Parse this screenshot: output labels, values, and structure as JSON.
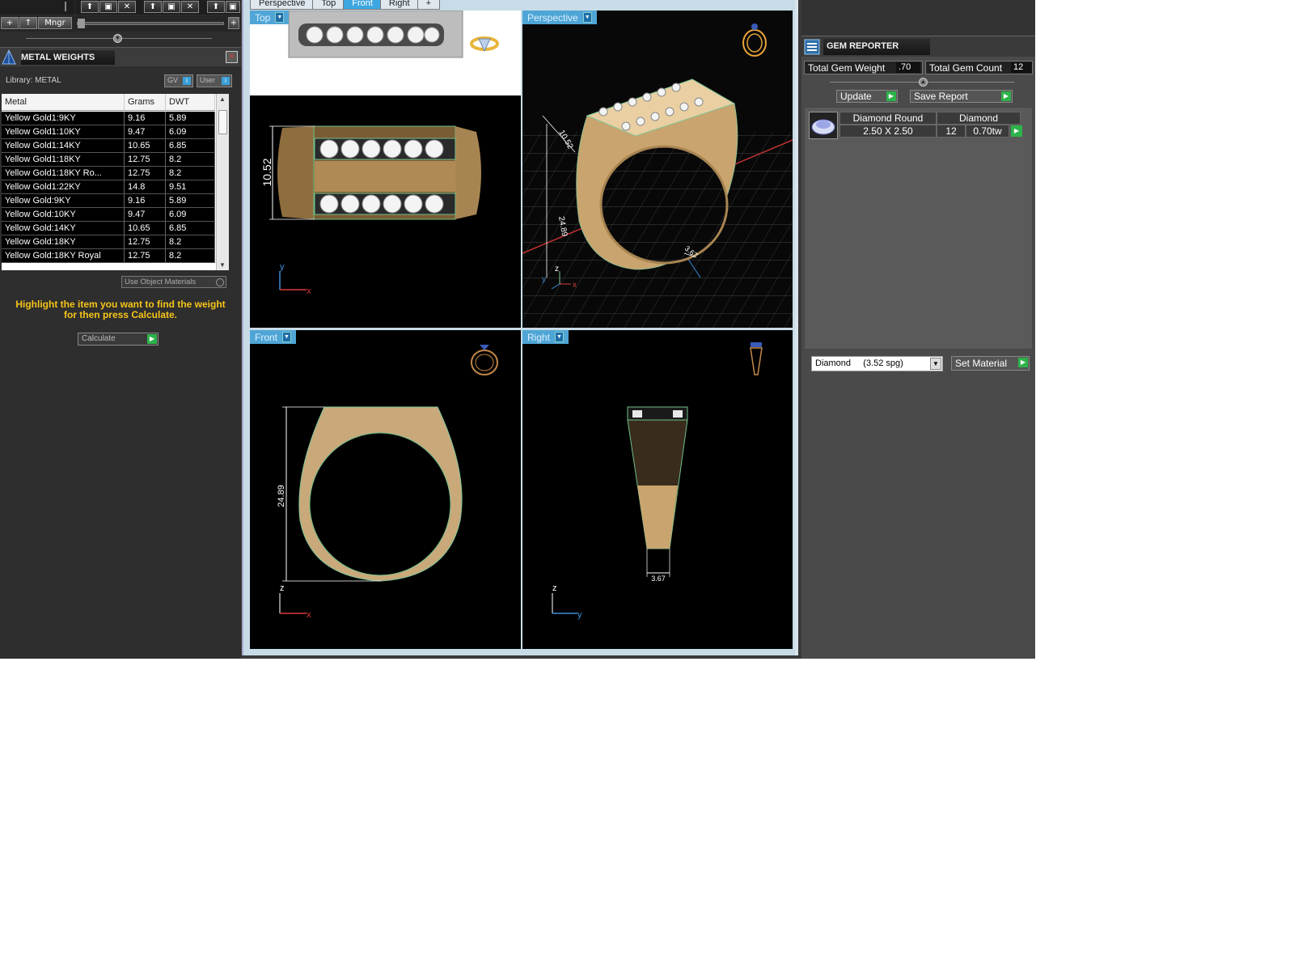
{
  "toolbar": {
    "add_label": "+",
    "up_label": "↑",
    "mngr_label": "Mngr",
    "plus_label": "+"
  },
  "metal_weights": {
    "title": "METAL WEIGHTS",
    "close_label": "×",
    "library_label": "Library: METAL",
    "gv_label": "GV",
    "user_label": "User",
    "columns": [
      "Metal",
      "Grams",
      "DWT"
    ],
    "rows": [
      [
        "Yellow Gold1:9KY",
        "9.16",
        "5.89"
      ],
      [
        "Yellow Gold1:10KY",
        "9.47",
        "6.09"
      ],
      [
        "Yellow Gold1:14KY",
        "10.65",
        "6.85"
      ],
      [
        "Yellow Gold1:18KY",
        "12.75",
        "8.2"
      ],
      [
        "Yellow Gold1:18KY Ro...",
        "12.75",
        "8.2"
      ],
      [
        "Yellow Gold1:22KY",
        "14.8",
        "9.51"
      ],
      [
        "Yellow Gold:9KY",
        "9.16",
        "5.89"
      ],
      [
        "Yellow Gold:10KY",
        "9.47",
        "6.09"
      ],
      [
        "Yellow Gold:14KY",
        "10.65",
        "6.85"
      ],
      [
        "Yellow Gold:18KY",
        "12.75",
        "8.2"
      ],
      [
        "Yellow Gold:18KY Royal",
        "12.75",
        "8.2"
      ]
    ],
    "use_object_materials": "Use Object Materials",
    "hint": "Highlight the item you want to find the weight for then press Calculate.",
    "calculate_label": "Calculate"
  },
  "viewport_tabs": [
    "Perspective",
    "Top",
    "Front",
    "Right",
    "+"
  ],
  "viewport_active_tab": "Front",
  "viewports": {
    "top": {
      "label": "Top",
      "dim": "10.52"
    },
    "perspective": {
      "label": "Perspective",
      "dim_a": "10.52",
      "dim_b": "24.89",
      "dim_c": "3.67"
    },
    "front": {
      "label": "Front",
      "dim": "24.89"
    },
    "right": {
      "label": "Right",
      "dim": "3.67"
    }
  },
  "axes": {
    "x": "x",
    "y": "y",
    "z": "z"
  },
  "gem_reporter": {
    "title": "GEM REPORTER",
    "total_weight_label": "Total Gem Weight",
    "total_weight_value": ".70",
    "total_count_label": "Total Gem Count",
    "total_count_value": "12",
    "update_label": "Update",
    "save_report_label": "Save Report",
    "gem": {
      "shape": "Diamond Round",
      "material": "Diamond",
      "size": "2.50 X 2.50",
      "count": "12",
      "weight": "0.70tw"
    },
    "material_select": "Diamond     (3.52 spg)",
    "set_material_label": "Set Material"
  },
  "colors": {
    "gold": "#c9a46e",
    "gold_dark": "#8e6d3e",
    "accent_blue": "#3ea6e0",
    "hint_yellow": "#f5c518",
    "go_green": "#2db34a"
  }
}
